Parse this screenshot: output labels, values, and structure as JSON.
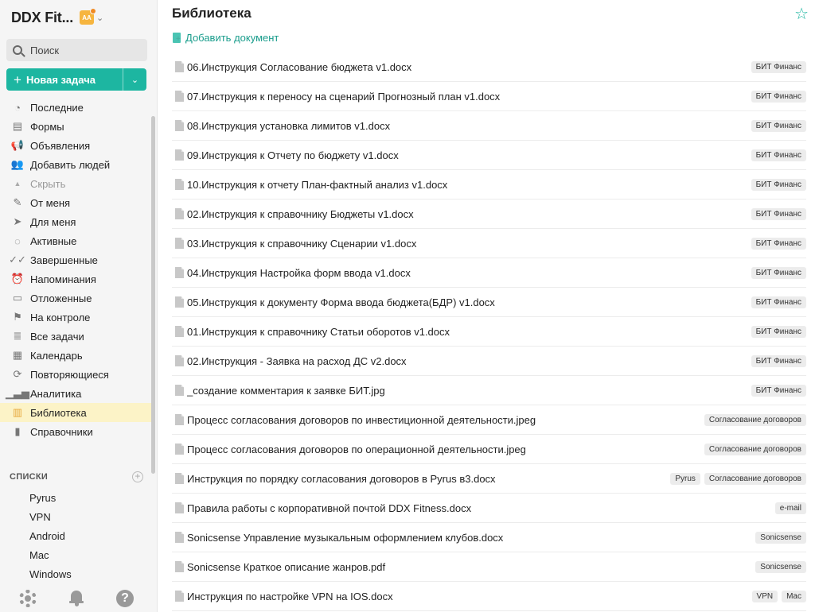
{
  "sidebar": {
    "workspace_name": "DDX Fit...",
    "avatar_initials": "AA",
    "search_placeholder": "Поиск",
    "new_task_label": "Новая задача",
    "nav": [
      {
        "label": "Последние",
        "icon": "clock-icon",
        "glyph": "◔"
      },
      {
        "label": "Формы",
        "icon": "forms-icon",
        "glyph": "▤"
      },
      {
        "label": "Объявления",
        "icon": "megaphone-icon",
        "glyph": "📢"
      },
      {
        "label": "Добавить людей",
        "icon": "add-people-icon",
        "glyph": "👥"
      },
      {
        "label": "Скрыть",
        "icon": "collapse-icon",
        "glyph": "▲"
      },
      {
        "label": "От меня",
        "icon": "pencil-icon",
        "glyph": "✎"
      },
      {
        "label": "Для меня",
        "icon": "send-icon",
        "glyph": "➤"
      },
      {
        "label": "Активные",
        "icon": "active-icon",
        "glyph": "◌"
      },
      {
        "label": "Завершенные",
        "icon": "done-icon",
        "glyph": "✓✓"
      },
      {
        "label": "Напоминания",
        "icon": "alarm-icon",
        "glyph": "⏰"
      },
      {
        "label": "Отложенные",
        "icon": "archive-icon",
        "glyph": "▭"
      },
      {
        "label": "На контроле",
        "icon": "flag-icon",
        "glyph": "⚑"
      },
      {
        "label": "Все задачи",
        "icon": "stack-icon",
        "glyph": "≣"
      },
      {
        "label": "Календарь",
        "icon": "calendar-icon",
        "glyph": "▦"
      },
      {
        "label": "Повторяющиеся",
        "icon": "repeat-icon",
        "glyph": "⟳"
      },
      {
        "label": "Аналитика",
        "icon": "analytics-icon",
        "glyph": "▁▃▅"
      },
      {
        "label": "Библиотека",
        "icon": "library-icon",
        "glyph": "▥"
      },
      {
        "label": "Справочники",
        "icon": "book-icon",
        "glyph": "▮"
      }
    ],
    "lists_header": "СПИСКИ",
    "lists": [
      "Pyrus",
      "VPN",
      "Android",
      "Mac",
      "Windows"
    ]
  },
  "main": {
    "title": "Библиотека",
    "add_document_label": "Добавить документ",
    "documents": [
      {
        "name": "06.Инструкция Согласование бюджета v1.docx",
        "tags": [
          "БИТ Финанс"
        ]
      },
      {
        "name": "07.Инструкция к переносу на сценарий Прогнозный план v1.docx",
        "tags": [
          "БИТ Финанс"
        ]
      },
      {
        "name": "08.Инструкция установка лимитов v1.docx",
        "tags": [
          "БИТ Финанс"
        ]
      },
      {
        "name": "09.Инструкция к Отчету по бюджету v1.docx",
        "tags": [
          "БИТ Финанс"
        ]
      },
      {
        "name": "10.Инструкция к отчету План-фактный анализ v1.docx",
        "tags": [
          "БИТ Финанс"
        ]
      },
      {
        "name": "02.Инструкция к справочнику Бюджеты v1.docx",
        "tags": [
          "БИТ Финанс"
        ]
      },
      {
        "name": "03.Инструкция к справочнику Сценарии v1.docx",
        "tags": [
          "БИТ Финанс"
        ]
      },
      {
        "name": "04.Инструкция Настройка форм ввода v1.docx",
        "tags": [
          "БИТ Финанс"
        ]
      },
      {
        "name": "05.Инструкция к документу Форма ввода бюджета(БДР) v1.docx",
        "tags": [
          "БИТ Финанс"
        ]
      },
      {
        "name": "01.Инструкция к справочнику Статьи оборотов v1.docx",
        "tags": [
          "БИТ Финанс"
        ]
      },
      {
        "name": "02.Инструкция - Заявка на расход ДС v2.docx",
        "tags": [
          "БИТ Финанс"
        ]
      },
      {
        "name": "_создание комментария к заявке БИТ.jpg",
        "tags": [
          "БИТ Финанс"
        ]
      },
      {
        "name": "Процесс согласования договоров по инвестиционной деятельности.jpeg",
        "tags": [
          "Согласование договоров"
        ]
      },
      {
        "name": "Процесс согласования договоров по операционной деятельности.jpeg",
        "tags": [
          "Согласование договоров"
        ]
      },
      {
        "name": "Инструкция по порядку согласования договоров в Pyrus в3.docx",
        "tags": [
          "Pyrus",
          "Согласование договоров"
        ]
      },
      {
        "name": "Правила работы с корпоративной почтой DDX Fitness.docx",
        "tags": [
          "e-mail"
        ]
      },
      {
        "name": "Sonicsense Управление музыкальным оформлением клубов.docx",
        "tags": [
          "Sonicsense"
        ]
      },
      {
        "name": "Sonicsense Краткое описание жанров.pdf",
        "tags": [
          "Sonicsense"
        ]
      },
      {
        "name": "Инструкция по настройке VPN на IOS.docx",
        "tags": [
          "VPN",
          "Mac"
        ]
      }
    ]
  },
  "colors": {
    "accent": "#1db6a1",
    "active_nav": "#fcf3c7",
    "avatar": "#f6b53f"
  }
}
